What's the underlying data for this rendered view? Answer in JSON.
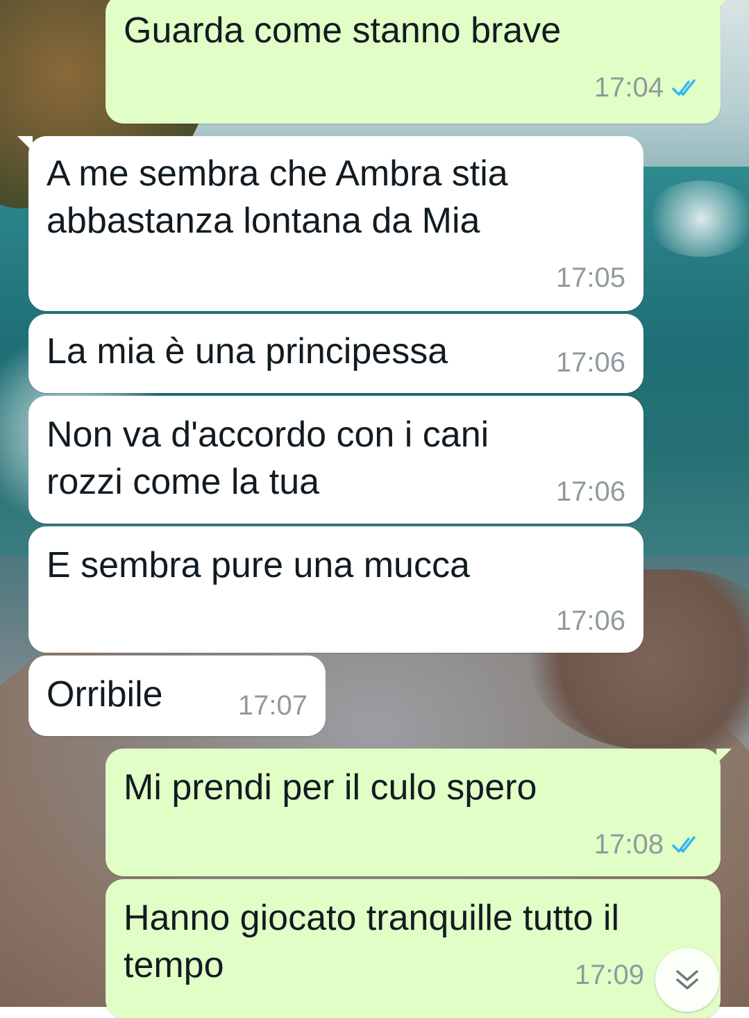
{
  "messages": [
    {
      "id": "m1",
      "direction": "outgoing",
      "text": "Guarda come stanno brave",
      "time": "17:04",
      "status": "read"
    },
    {
      "id": "m2",
      "direction": "incoming",
      "text": "A me sembra che Ambra stia\nabbastanza lontana da Mia",
      "time": "17:05"
    },
    {
      "id": "m3",
      "direction": "incoming",
      "text": "La mia è una principessa",
      "time": "17:06"
    },
    {
      "id": "m4",
      "direction": "incoming",
      "text": "Non va d'accordo con i cani\nrozzi come la tua",
      "time": "17:06"
    },
    {
      "id": "m5",
      "direction": "incoming",
      "text": "E sembra pure una mucca",
      "time": "17:06"
    },
    {
      "id": "m6",
      "direction": "incoming",
      "text": "Orribile",
      "time": "17:07"
    },
    {
      "id": "m7",
      "direction": "outgoing",
      "text": "Mi prendi per il culo spero",
      "time": "17:08",
      "status": "read"
    },
    {
      "id": "m8",
      "direction": "outgoing",
      "text": "Hanno giocato tranquille tutto il\ntempo",
      "time": "17:09",
      "status": "read"
    }
  ],
  "scroll_button": {
    "icon": "double-chevron-down-icon"
  },
  "colors": {
    "outgoing_bubble": "#e1fec6",
    "incoming_bubble": "#ffffff",
    "read_ticks": "#34b7f1",
    "time_text": "#8f9a9d"
  }
}
